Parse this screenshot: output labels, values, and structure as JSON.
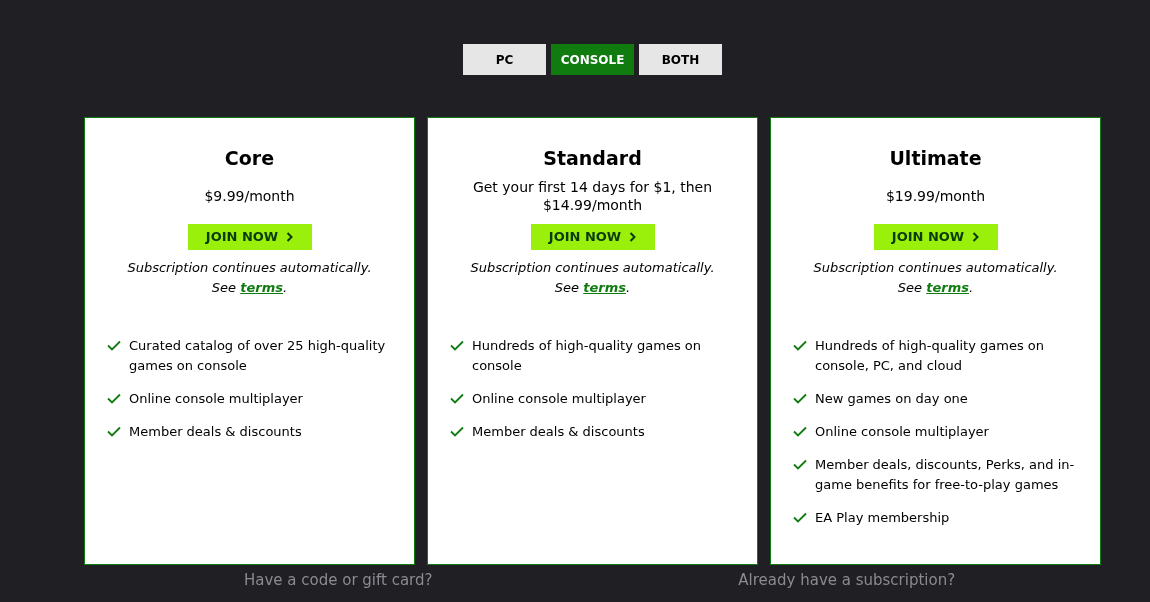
{
  "platform_tabs": [
    {
      "label": "PC",
      "selected": false
    },
    {
      "label": "CONSOLE",
      "selected": true
    },
    {
      "label": "BOTH",
      "selected": false
    }
  ],
  "plans": [
    {
      "name": "Core",
      "price": "$9.99/month",
      "button": "JOIN NOW",
      "note": "Subscription continues automatically.",
      "see": "See",
      "terms_link": "terms",
      "after": ".",
      "features": [
        "Curated catalog of over 25 high-quality games on console",
        "Online console multiplayer",
        "Member deals & discounts"
      ]
    },
    {
      "name": "Standard",
      "price": "Get your first 14 days for $1, then $14.99/month",
      "button": "JOIN NOW",
      "note": "Subscription continues automatically.",
      "see": "See",
      "terms_link": "terms",
      "after": ".",
      "features": [
        "Hundreds of high-quality games on console",
        "Online console multiplayer",
        "Member deals & discounts"
      ]
    },
    {
      "name": "Ultimate",
      "price": "$19.99/month",
      "button": "JOIN NOW",
      "note": "Subscription continues automatically.",
      "see": "See",
      "terms_link": "terms",
      "after": ".",
      "features": [
        "Hundreds of high-quality games on console, PC, and cloud",
        "New games on day one",
        "Online console multiplayer",
        "Member deals, discounts, Perks, and in-game benefits for free-to-play games",
        "EA Play membership"
      ]
    }
  ],
  "footer_links": [
    "Have a code or gift card?",
    "Already have a subscription?"
  ]
}
